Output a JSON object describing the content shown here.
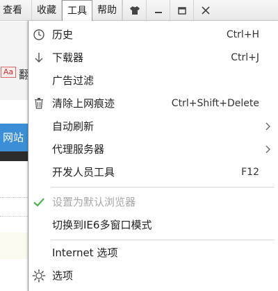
{
  "menubar": {
    "items": [
      {
        "label": "查看",
        "active": false
      },
      {
        "label": "收藏",
        "active": false
      },
      {
        "label": "工具",
        "active": true
      },
      {
        "label": "帮助",
        "active": false
      }
    ],
    "window_controls": [
      "skin-icon",
      "minimize-icon",
      "restore-icon",
      "close-icon"
    ]
  },
  "background": {
    "aa_icon_text": "Aa",
    "partial_char": "翻",
    "blue_band_text": "网站"
  },
  "dropdown": {
    "items": [
      {
        "label": "历史",
        "shortcut": "Ctrl+H",
        "icon": "clock-icon",
        "submenu": false,
        "disabled": false
      },
      {
        "label": "下载器",
        "shortcut": "Ctrl+J",
        "icon": "download-arrow-icon",
        "submenu": false,
        "disabled": false
      },
      {
        "label": "广告过滤",
        "shortcut": "",
        "icon": "",
        "submenu": false,
        "disabled": false
      },
      {
        "label": "清除上网痕迹",
        "shortcut": "Ctrl+Shift+Delete",
        "icon": "trash-icon",
        "submenu": false,
        "disabled": false
      },
      {
        "label": "自动刷新",
        "shortcut": "",
        "icon": "",
        "submenu": true,
        "disabled": false
      },
      {
        "label": "代理服务器",
        "shortcut": "",
        "icon": "",
        "submenu": true,
        "disabled": false
      },
      {
        "label": "开发人员工具",
        "shortcut": "F12",
        "icon": "",
        "submenu": false,
        "disabled": false
      },
      {
        "label": "设置为默认浏览器",
        "shortcut": "",
        "icon": "checkmark-icon",
        "submenu": false,
        "disabled": true
      },
      {
        "label": "切换到IE6多窗口模式",
        "shortcut": "",
        "icon": "",
        "submenu": false,
        "disabled": false
      },
      {
        "label": "Internet 选项",
        "shortcut": "",
        "icon": "",
        "submenu": false,
        "disabled": false
      },
      {
        "label": "选项",
        "shortcut": "",
        "icon": "gear-icon",
        "submenu": false,
        "disabled": false
      }
    ]
  },
  "colors": {
    "checkmark": "#4caf50",
    "disabled_text": "#a8a8a8",
    "accent_blue": "#3c8fd6"
  }
}
